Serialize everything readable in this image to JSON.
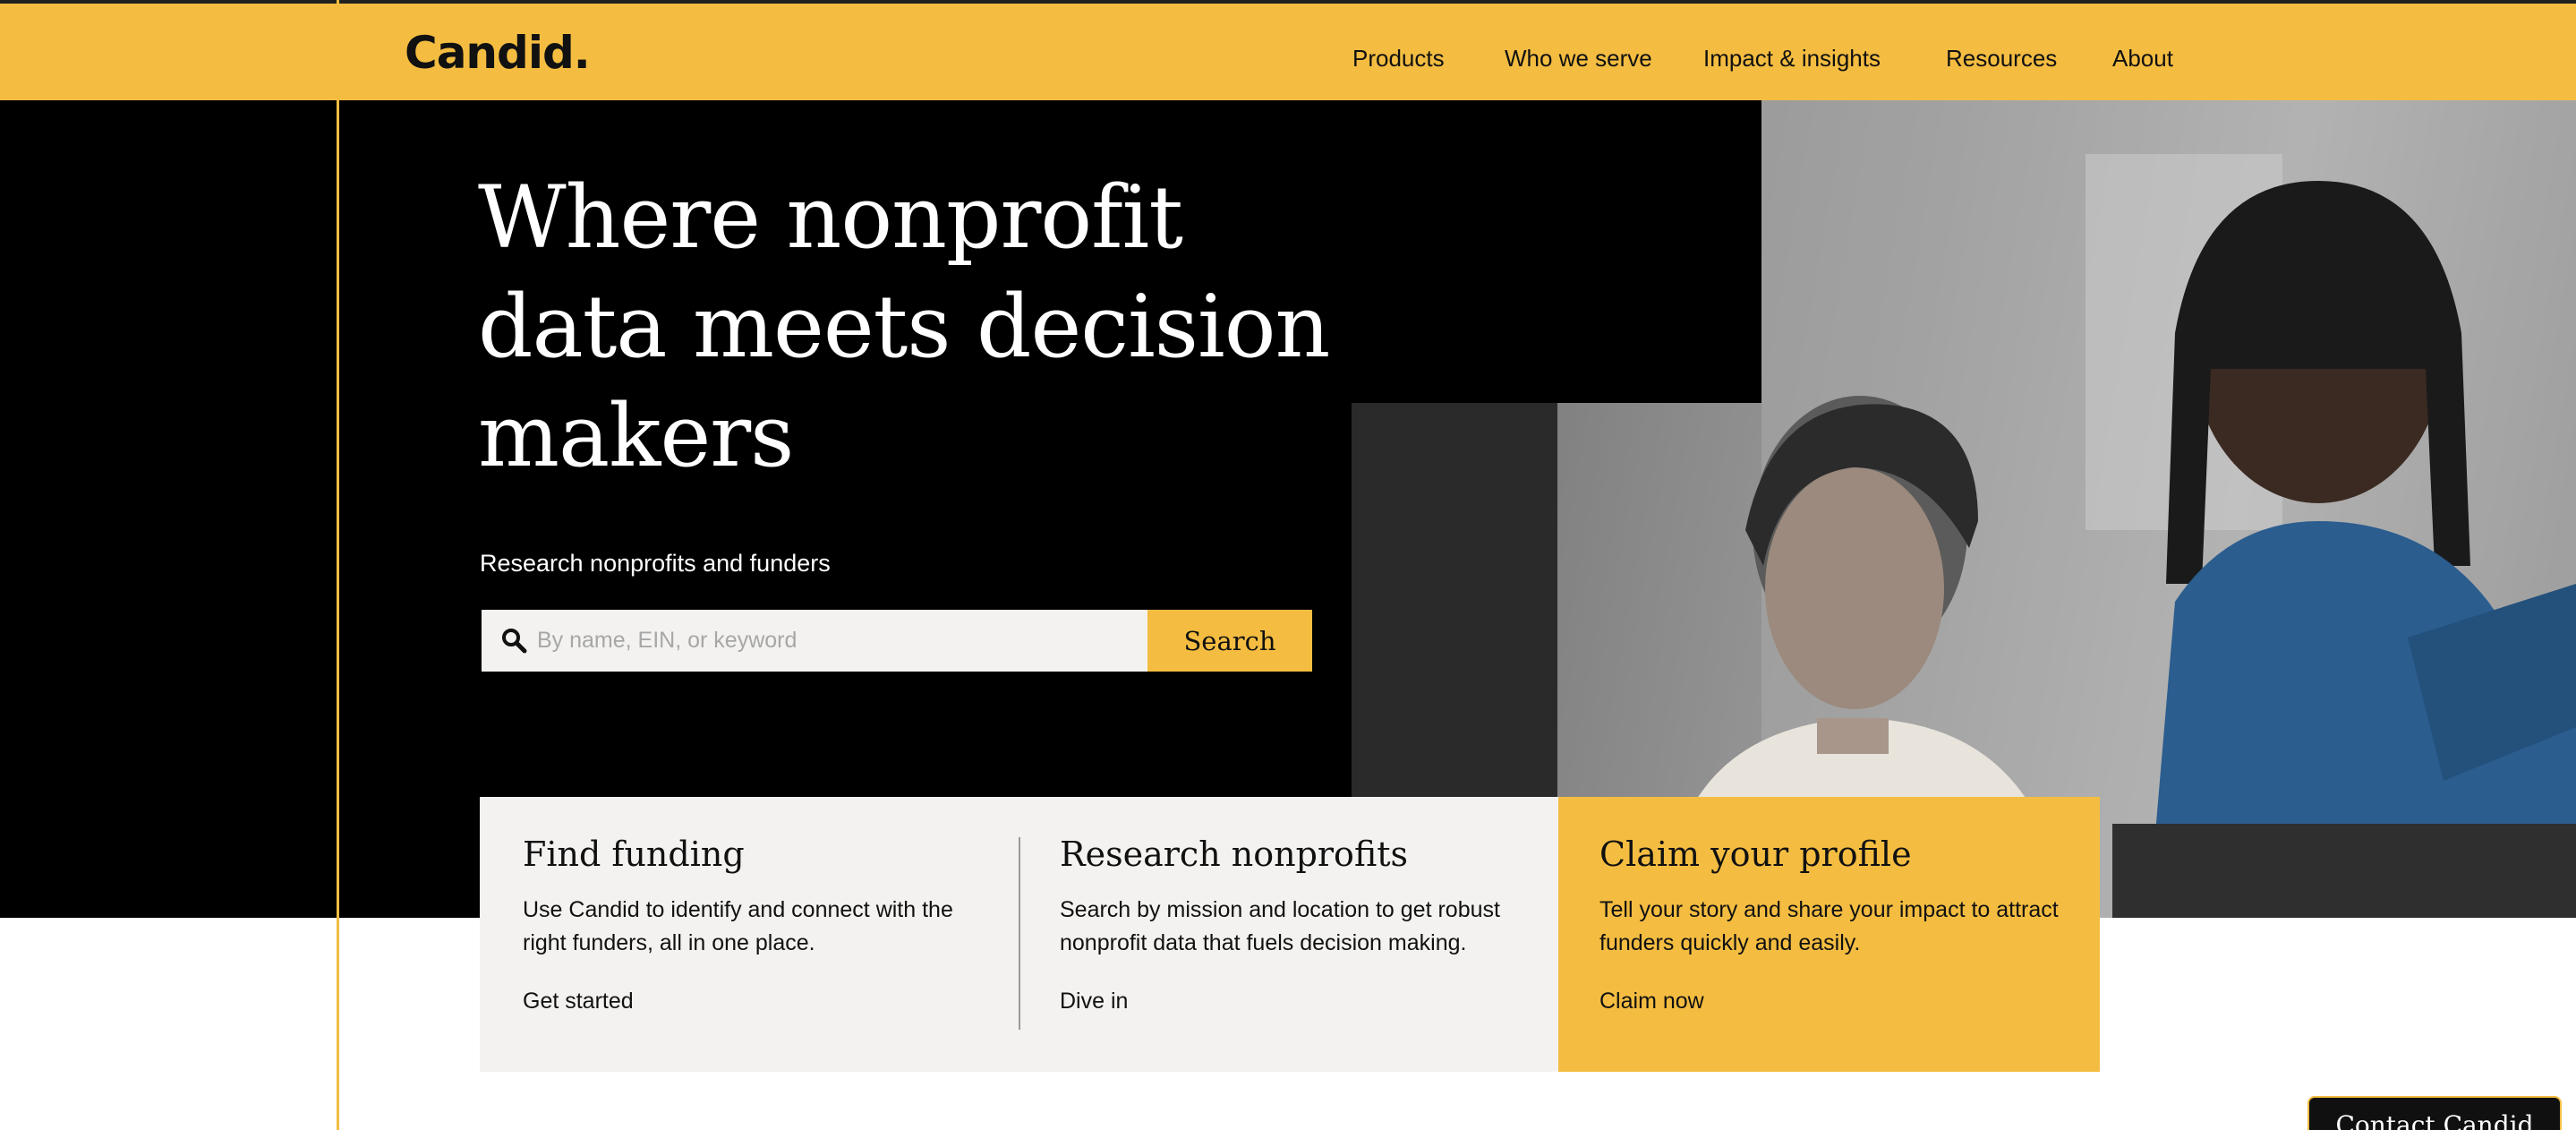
{
  "brand": {
    "logo_text": "Candid."
  },
  "nav": {
    "items": [
      "Products",
      "Who we serve",
      "Impact & insights",
      "Resources",
      "About"
    ]
  },
  "hero": {
    "headline_lines": [
      "Where nonprofit",
      "data meets decision",
      "makers"
    ],
    "search_label": "Research nonprofits and funders",
    "search_placeholder": "By name, EIN, or keyword",
    "search_button": "Search"
  },
  "cards": [
    {
      "title": "Find funding",
      "desc": "Use Candid to identify and connect with the right funders, all in one place.",
      "link": "Get started"
    },
    {
      "title": "Research nonprofits",
      "desc": "Search by mission and location to get robust nonprofit data that fuels decision making.",
      "link": "Dive in"
    },
    {
      "title": "Claim your profile",
      "desc": "Tell your story and share your impact to attract funders quickly and easily.",
      "link": "Claim now"
    }
  ],
  "contact": {
    "label": "Contact Candid"
  },
  "colors": {
    "brand_yellow": "#f4bd41",
    "hero_black": "#000000",
    "card_gray": "#f3f2f0"
  },
  "icons": {
    "search": "search-icon"
  }
}
